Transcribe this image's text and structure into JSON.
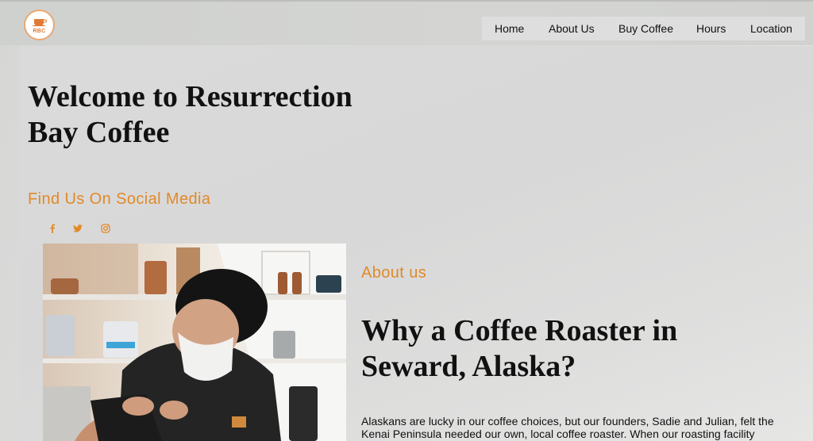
{
  "header": {
    "logo_text": "RBC",
    "nav": [
      {
        "label": "Home"
      },
      {
        "label": "About Us"
      },
      {
        "label": "Buy Coffee"
      },
      {
        "label": "Hours"
      },
      {
        "label": "Location"
      }
    ]
  },
  "hero": {
    "title_line1": "Welcome to Resurrection",
    "title_line2": "Bay Coffee"
  },
  "social": {
    "heading": "Find Us On Social Media",
    "icons": [
      "facebook-icon",
      "twitter-icon",
      "instagram-icon"
    ]
  },
  "about": {
    "label": "About us",
    "heading_line1": "Why a Coffee Roaster in",
    "heading_line2": "Seward, Alaska?",
    "paragraph": "Alaskans are lucky in our coffee choices, but our founders, Sadie and Julian, felt the Kenai Peninsula needed our own, local coffee roaster. When our roasting facility"
  },
  "colors": {
    "accent": "#e08a2a",
    "logo_border": "#e9a870",
    "text": "#111111"
  }
}
